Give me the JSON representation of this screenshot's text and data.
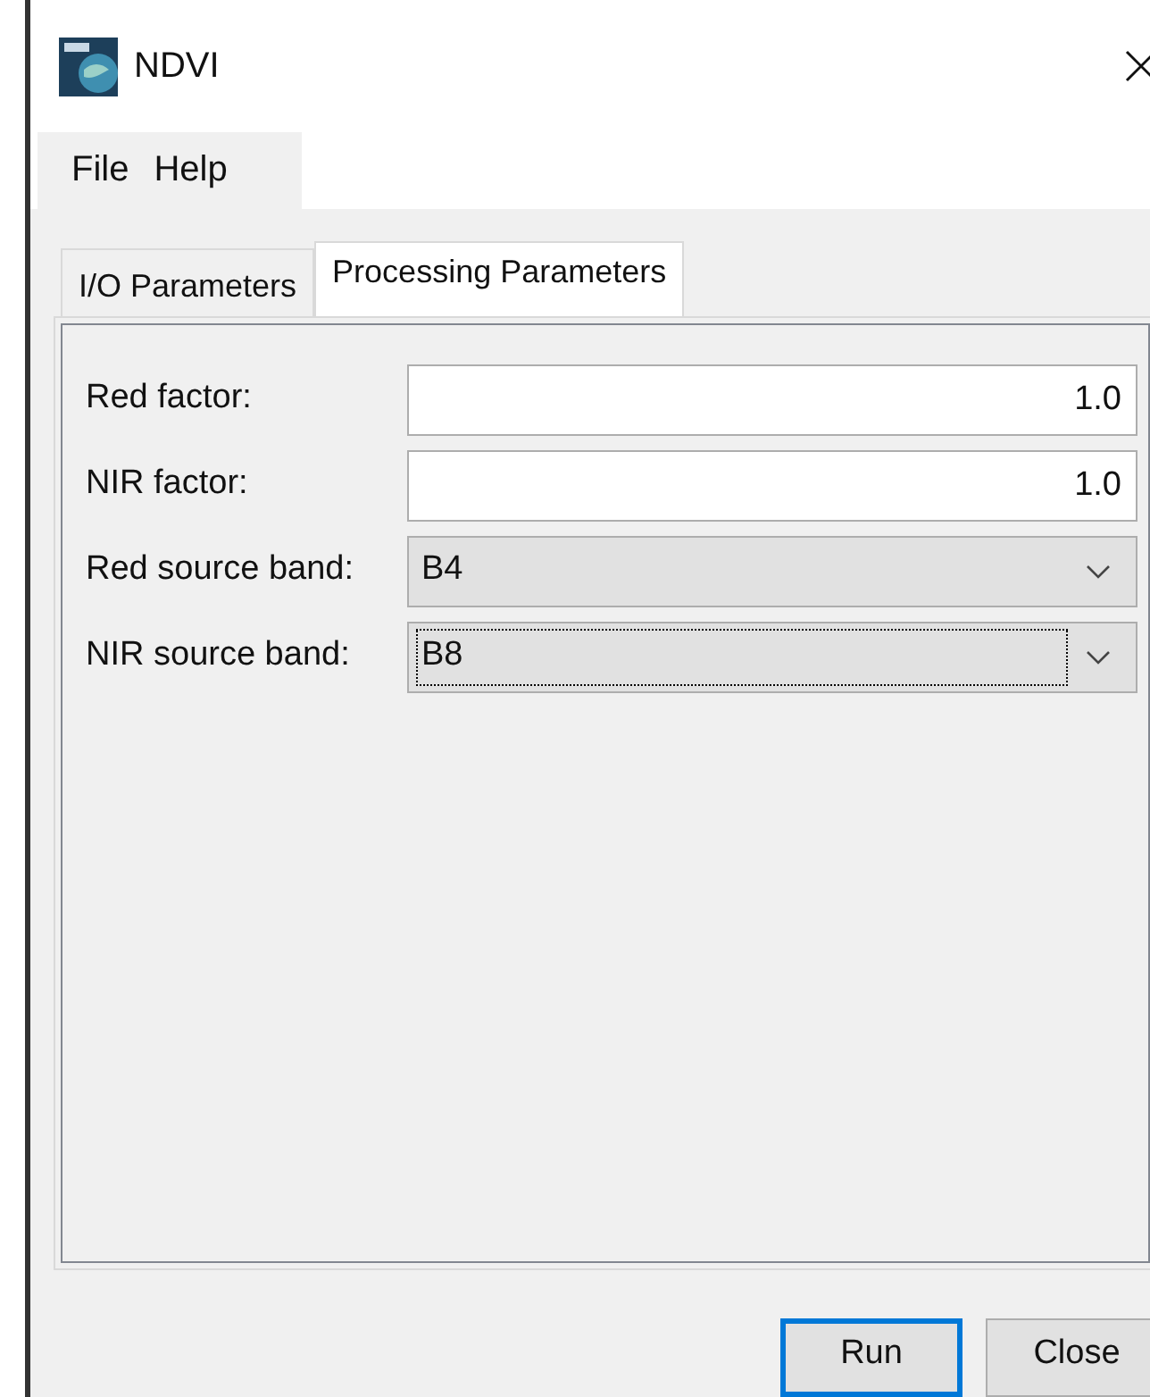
{
  "window": {
    "title": "NDVI"
  },
  "menu": [
    "File",
    "Help"
  ],
  "tabs": [
    {
      "label": "I/O Parameters",
      "selected": false
    },
    {
      "label": "Processing Parameters",
      "selected": true
    }
  ],
  "parameters": [
    {
      "kind": "text",
      "label": "Red factor:",
      "value": "1.0",
      "focused": false
    },
    {
      "kind": "text",
      "label": "NIR factor:",
      "value": "1.0",
      "focused": false
    },
    {
      "kind": "dropdown",
      "label": "Red source band:",
      "value": "B4",
      "focused": false
    },
    {
      "kind": "dropdown",
      "label": "NIR source band:",
      "value": "B8",
      "focused": true
    }
  ],
  "buttons": [
    {
      "label": "Run",
      "default": true
    },
    {
      "label": "Close",
      "default": false
    }
  ]
}
